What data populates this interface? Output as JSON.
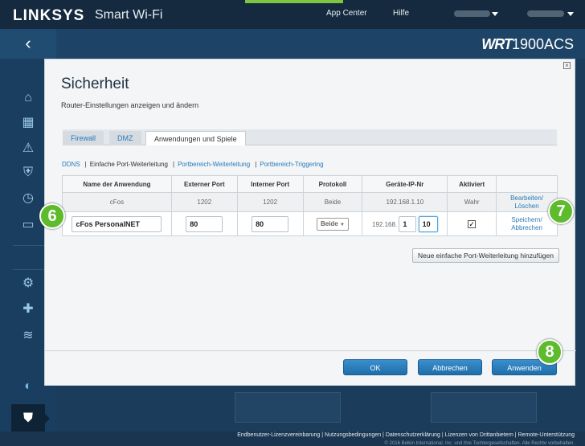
{
  "header": {
    "brand": "LINKSYS",
    "product": "Smart Wi-Fi",
    "links": [
      "App Center",
      "Hilfe"
    ],
    "model_prefix": "WRT",
    "model_number": "1900ACS"
  },
  "dialog": {
    "title": "Sicherheit",
    "subtitle": "Router-Einstellungen anzeigen und ändern",
    "tabs": [
      "Firewall",
      "DMZ",
      "Anwendungen und Spiele"
    ],
    "subnav": [
      "DDNS",
      "Einfache Port-Weiterleitung",
      "Portbereich-Weiterleitung",
      "Portbereich-Triggering"
    ],
    "table": {
      "headers": [
        "Name der Anwendung",
        "Externer Port",
        "Interner Port",
        "Protokoll",
        "Geräte-IP-Nr",
        "Aktiviert",
        ""
      ],
      "row1": {
        "name": "cFos",
        "ext_port": "1202",
        "int_port": "1202",
        "protocol": "Beide",
        "ip": "192.168.1.10",
        "enabled": "Wahr",
        "action1": "Bearbeiten/",
        "action2": "Löschen"
      },
      "row2": {
        "name": "cFos PersonalNET",
        "ext_port": "80",
        "int_port": "80",
        "protocol": "Beide",
        "ip_prefix": "192.168.",
        "ip_third": "1",
        "ip_fourth": "10",
        "enabled_mark": "✓",
        "action1": "Speichern/",
        "action2": "Abbrechen"
      }
    },
    "add_button": "Neue einfache Port-Weiterleitung hinzufügen",
    "buttons": {
      "ok": "OK",
      "cancel": "Abbrechen",
      "apply": "Anwenden"
    },
    "markers": [
      "6",
      "7",
      "8"
    ]
  },
  "footer": {
    "links": [
      "Endbenutzer-Lizenzvereinbarung",
      "Nutzungsbedingungen",
      "Datenschutzerklärung",
      "Lizenzen von Drittanbietern",
      "Remote-Unterstützung"
    ],
    "copyright": "© 2016 Belkin International, Inc. und ihre Tochtergesellschaften. Alle Rechte vorbehalten."
  }
}
